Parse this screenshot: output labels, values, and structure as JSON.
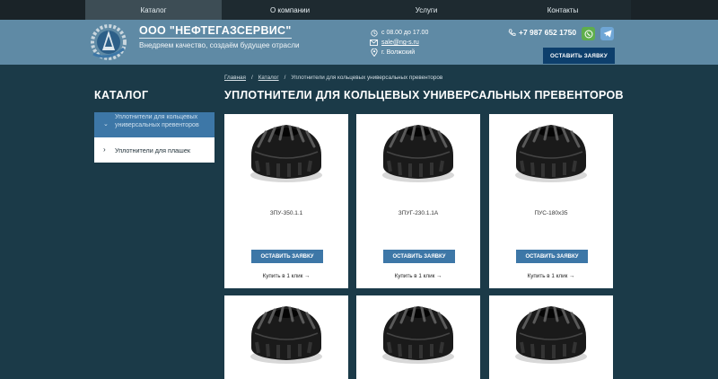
{
  "nav": {
    "items": [
      {
        "label": "Каталог"
      },
      {
        "label": "О компании"
      },
      {
        "label": "Услуги"
      },
      {
        "label": "Контакты"
      }
    ]
  },
  "header": {
    "brand": "ООО \"НЕФТЕГАЗСЕРВИС\"",
    "slogan": "Внедряем качество, создаём будущее отрасли",
    "hours": "с 08.00 до 17.00",
    "email": "sale@ng-s.ru",
    "city": "г. Волжский",
    "phone": "+7 987 652 1750",
    "request_button": "ОСТАВИТЬ ЗАЯВКУ"
  },
  "breadcrumb": {
    "home": "Главная",
    "sep1": "/",
    "catalog": "Каталог",
    "sep2": "/",
    "current": "Уплотнители для кольцевых универсальных превенторов"
  },
  "sidebar": {
    "title": "КАТАЛОГ",
    "items": [
      {
        "label": "Уплотнители для кольцевых универсальных превенторов"
      },
      {
        "label": "Уплотнители для плашек"
      }
    ]
  },
  "main": {
    "title": "УПЛОТНИТЕЛИ ДЛЯ КОЛЬЦЕВЫХ УНИВЕРСАЛЬНЫХ ПРЕВЕНТОРОВ",
    "products": [
      {
        "name": "ЗПУ-350.1.1",
        "button": "ОСТАВИТЬ ЗАЯВКУ",
        "buy": "Купить в 1 клик"
      },
      {
        "name": "ЗПУГ-230.1.1А",
        "button": "ОСТАВИТЬ ЗАЯВКУ",
        "buy": "Купить в 1 клик"
      },
      {
        "name": "ПУС-180х35",
        "button": "ОСТАВИТЬ ЗАЯВКУ",
        "buy": "Купить в 1 клик"
      }
    ]
  },
  "colors": {
    "background": "#1b3a48",
    "header": "#5f8aa5",
    "accent": "#3d77a7",
    "button_dark": "#0d3f6c"
  },
  "icons": [
    "logo-icon",
    "clock-icon",
    "mail-icon",
    "location-icon",
    "phone-icon",
    "whatsapp-icon",
    "telegram-icon",
    "chevron-right-icon",
    "arrow-right-icon"
  ]
}
